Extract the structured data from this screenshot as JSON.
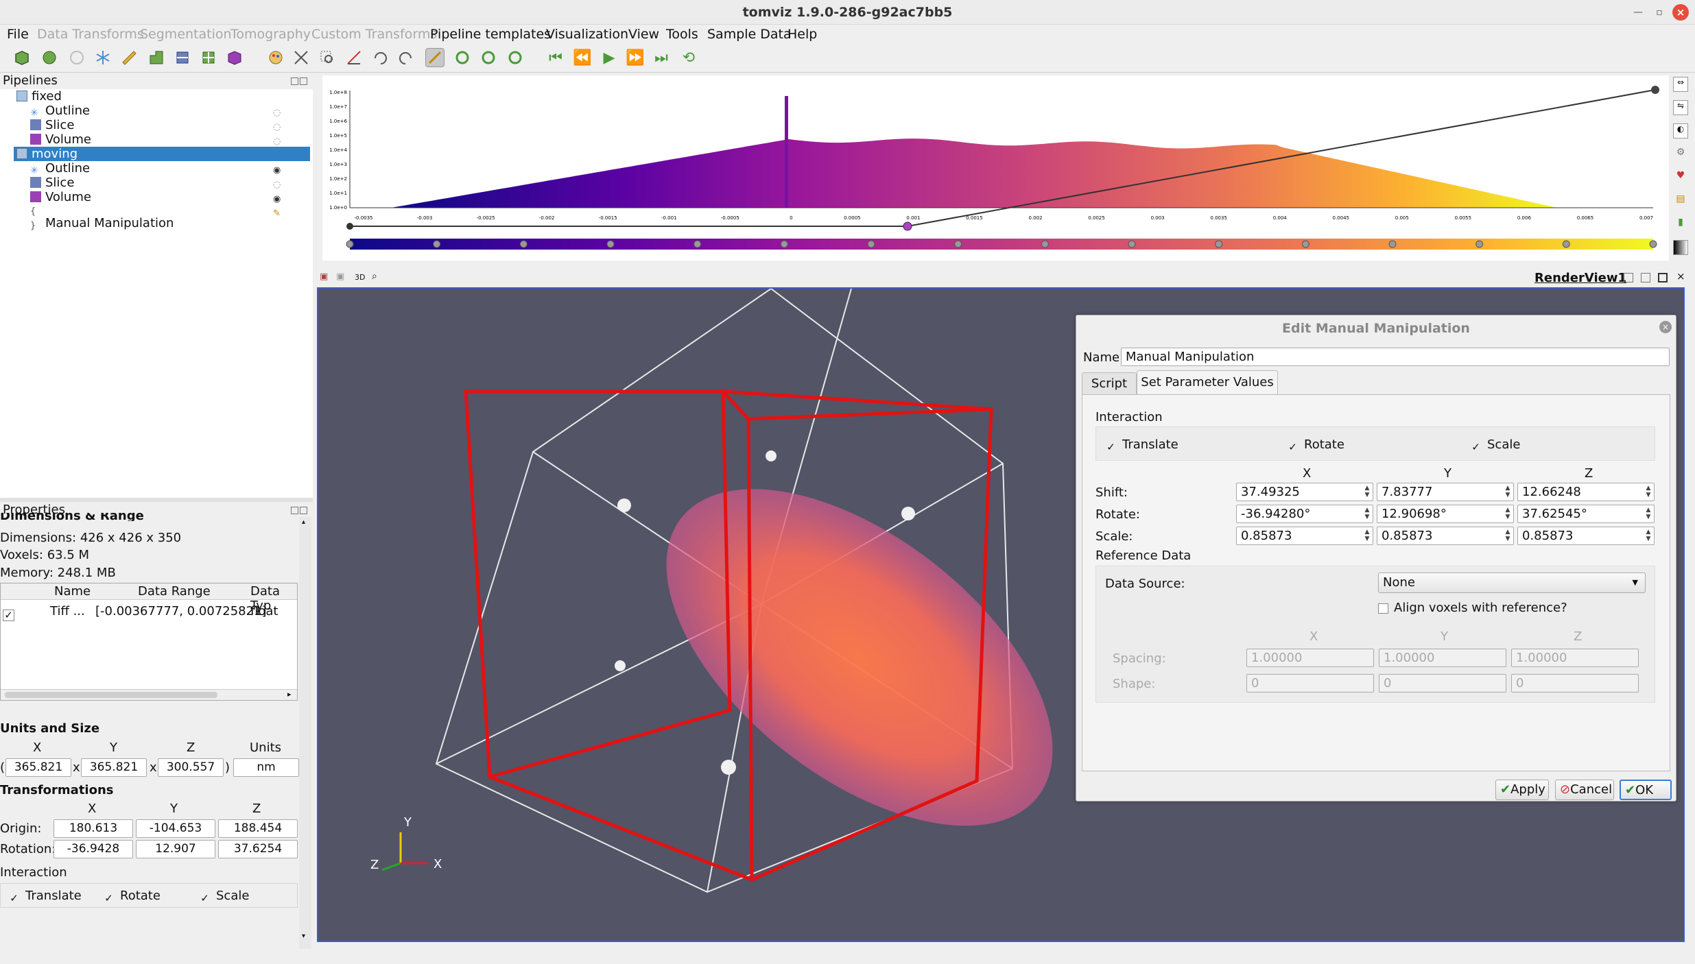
{
  "window": {
    "title": "tomviz 1.9.0-286-g92ac7bb5"
  },
  "menu": {
    "items": [
      {
        "label": "File",
        "enabled": true
      },
      {
        "label": "Data Transforms",
        "enabled": false
      },
      {
        "label": "Segmentation",
        "enabled": false
      },
      {
        "label": "Tomography",
        "enabled": false
      },
      {
        "label": "Custom Transforms",
        "enabled": false
      },
      {
        "label": "Pipeline templates",
        "enabled": true
      },
      {
        "label": "Visualization",
        "enabled": true
      },
      {
        "label": "View",
        "enabled": true
      },
      {
        "label": "Tools",
        "enabled": true
      },
      {
        "label": "Sample Data",
        "enabled": true
      },
      {
        "label": "Help",
        "enabled": true
      }
    ]
  },
  "pipelines": {
    "title": "Pipelines",
    "items": [
      {
        "label": "fixed",
        "type": "data"
      },
      {
        "label": "Outline",
        "type": "outline"
      },
      {
        "label": "Slice",
        "type": "slice"
      },
      {
        "label": "Volume",
        "type": "volume"
      },
      {
        "label": "moving",
        "type": "data"
      },
      {
        "label": "Outline",
        "type": "outline"
      },
      {
        "label": "Slice",
        "type": "slice"
      },
      {
        "label": "Volume",
        "type": "volume"
      },
      {
        "label": "Manual Manipulation",
        "type": "operator"
      }
    ]
  },
  "properties": {
    "title": "Properties",
    "section_clipped": "Dimensions & Range",
    "dimensions": "Dimensions: 426 x 426 x 350",
    "voxels": "Voxels: 63.5 M",
    "memory": "Memory: 248.1 MB",
    "table": {
      "headers": [
        "Name",
        "Data Range",
        "Data Typ"
      ],
      "row": {
        "checked": "✓",
        "name": "Tiff ...",
        "range": "[-0.00367777, 0.00725821]",
        "type": "float"
      }
    },
    "units_title": "Units and Size",
    "units_headers": [
      "X",
      "Y",
      "Z",
      "Units"
    ],
    "size": {
      "x": "365.821",
      "y": "365.821",
      "z": "300.557",
      "units": "nm",
      "open": "(",
      "close": ")",
      "sep": "x"
    },
    "transforms_title": "Transformations",
    "transforms_headers": [
      "X",
      "Y",
      "Z"
    ],
    "origin": {
      "label": "Origin:",
      "x": "180.613",
      "y": "-104.653",
      "z": "188.454"
    },
    "rotation": {
      "label": "Rotation:",
      "x": "-36.9428",
      "y": "12.907",
      "z": "37.6254"
    },
    "interaction_title": "Interaction",
    "interaction": {
      "translate": "Translate",
      "rotate": "Rotate",
      "scale": "Scale",
      "check": "✓"
    }
  },
  "histogram": {
    "ticks": [
      "-0.0035",
      "-0.003",
      "-0.0025",
      "-0.002",
      "-0.0015",
      "-0.001",
      "-0.0005",
      "0",
      "0.0005",
      "0.001",
      "0.0015",
      "0.002",
      "0.0025",
      "0.003",
      "0.0035",
      "0.004",
      "0.0045",
      "0.005",
      "0.0055",
      "0.006",
      "0.0065",
      "0.007"
    ],
    "y_ticks": [
      "1.0e+8",
      "1.0e+7",
      "1.0e+6",
      "1.0e+5",
      "1.0e+4",
      "1.0e+3",
      "1.0e+2",
      "1.0e+1",
      "1.0e+0"
    ]
  },
  "render_view": {
    "label": "RenderView1",
    "axis": {
      "x": "X",
      "y": "Y",
      "z": "Z"
    },
    "toolbar_3d": "3D"
  },
  "dialog": {
    "title": "Edit Manual Manipulation",
    "name_label": "Name",
    "name_value": "Manual Manipulation",
    "tabs": [
      "Script",
      "Set Parameter Values"
    ],
    "interaction_label": "Interaction",
    "check": "✓",
    "translate": "Translate",
    "rotate": "Rotate",
    "scale": "Scale",
    "col_headers": [
      "X",
      "Y",
      "Z"
    ],
    "shift": {
      "label": "Shift:",
      "x": "37.49325",
      "y": "7.83777",
      "z": "12.66248"
    },
    "rotate_row": {
      "label": "Rotate:",
      "x": "-36.94280°",
      "y": "12.90698°",
      "z": "37.62545°"
    },
    "scale_row": {
      "label": "Scale:",
      "x": "0.85873",
      "y": "0.85873",
      "z": "0.85873"
    },
    "reference_label": "Reference Data",
    "data_source_label": "Data Source:",
    "data_source_value": "None",
    "align_label": "Align voxels with reference?",
    "spacing": {
      "label": "Spacing:",
      "x": "1.00000",
      "y": "1.00000",
      "z": "1.00000"
    },
    "shape": {
      "label": "Shape:",
      "x": "0",
      "y": "0",
      "z": "0"
    },
    "buttons": {
      "apply": "Apply",
      "cancel": "Cancel",
      "ok": "OK"
    }
  }
}
